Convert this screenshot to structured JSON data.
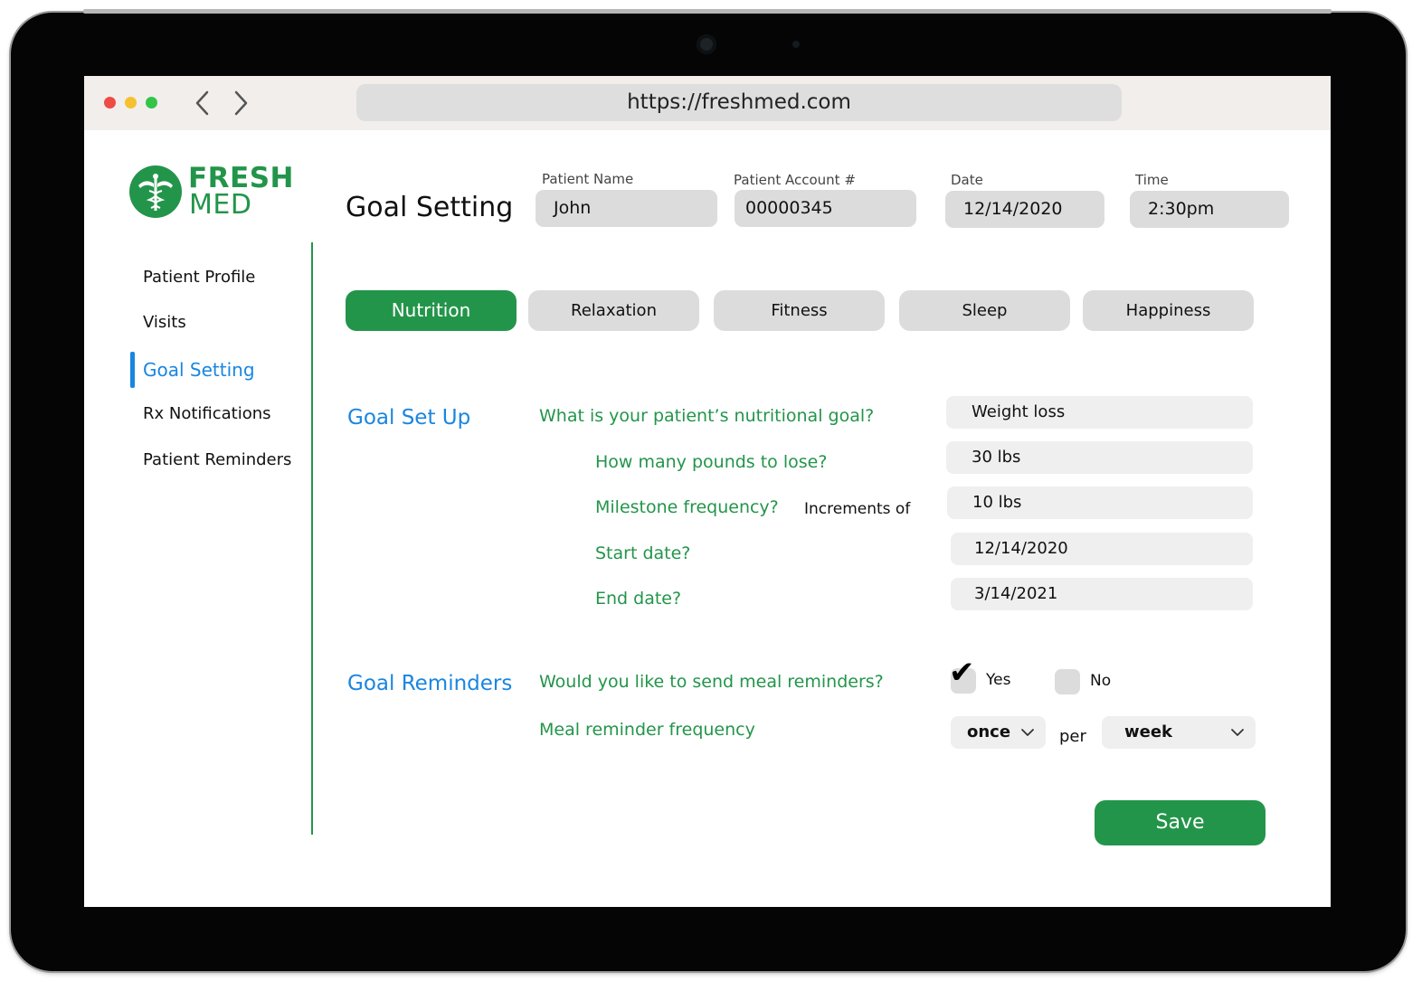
{
  "browser": {
    "url": "https://freshmed.com",
    "window_controls": [
      "close-dot",
      "minimize-dot",
      "maximize-dot"
    ],
    "nav": {
      "back_icon": "chevron-left",
      "forward_icon": "chevron-right"
    }
  },
  "brand": {
    "name_line1": "FRESH",
    "name_line2": "MED",
    "logo_icon": "caduceus",
    "color": "#23954a"
  },
  "header": {
    "title": "Goal Setting",
    "fields": [
      {
        "label": "Patient Name",
        "value": "John"
      },
      {
        "label": "Patient Account #",
        "value": "00000345"
      },
      {
        "label": "Date",
        "value": "12/14/2020"
      },
      {
        "label": "Time",
        "value": "2:30pm"
      }
    ]
  },
  "sidebar": {
    "items": [
      {
        "label": "Patient Profile",
        "active": false
      },
      {
        "label": "Visits",
        "active": false
      },
      {
        "label": "Goal Setting",
        "active": true
      },
      {
        "label": "Rx Notifications",
        "active": false
      },
      {
        "label": "Patient Reminders",
        "active": false
      }
    ]
  },
  "tabs": [
    {
      "label": "Nutrition",
      "active": true
    },
    {
      "label": "Relaxation",
      "active": false
    },
    {
      "label": "Fitness",
      "active": false
    },
    {
      "label": "Sleep",
      "active": false
    },
    {
      "label": "Happiness",
      "active": false
    }
  ],
  "goal_setup": {
    "title": "Goal Set Up",
    "questions": [
      {
        "question": "What is your patient’s nutritional goal?",
        "answer": "Weight loss"
      },
      {
        "question": "How many pounds to lose?",
        "answer": "30 lbs"
      },
      {
        "question": "Milestone frequency?",
        "note": "Increments of",
        "answer": "10 lbs"
      },
      {
        "question": "Start date?",
        "answer": "12/14/2020"
      },
      {
        "question": "End date?",
        "answer": "3/14/2021"
      }
    ]
  },
  "goal_reminders": {
    "title": "Goal Reminders",
    "send_question": "Would you like to send meal reminders?",
    "yes_label": "Yes",
    "no_label": "No",
    "yes_checked": true,
    "frequency_question": "Meal reminder frequency",
    "frequency_count": "once",
    "per_label": "per",
    "frequency_period": "week"
  },
  "actions": {
    "save_label": "Save"
  },
  "colors": {
    "primary_green": "#23954a",
    "active_blue": "#1a86e0",
    "field_gray": "#dcdcdc",
    "answer_gray": "#efefef"
  }
}
